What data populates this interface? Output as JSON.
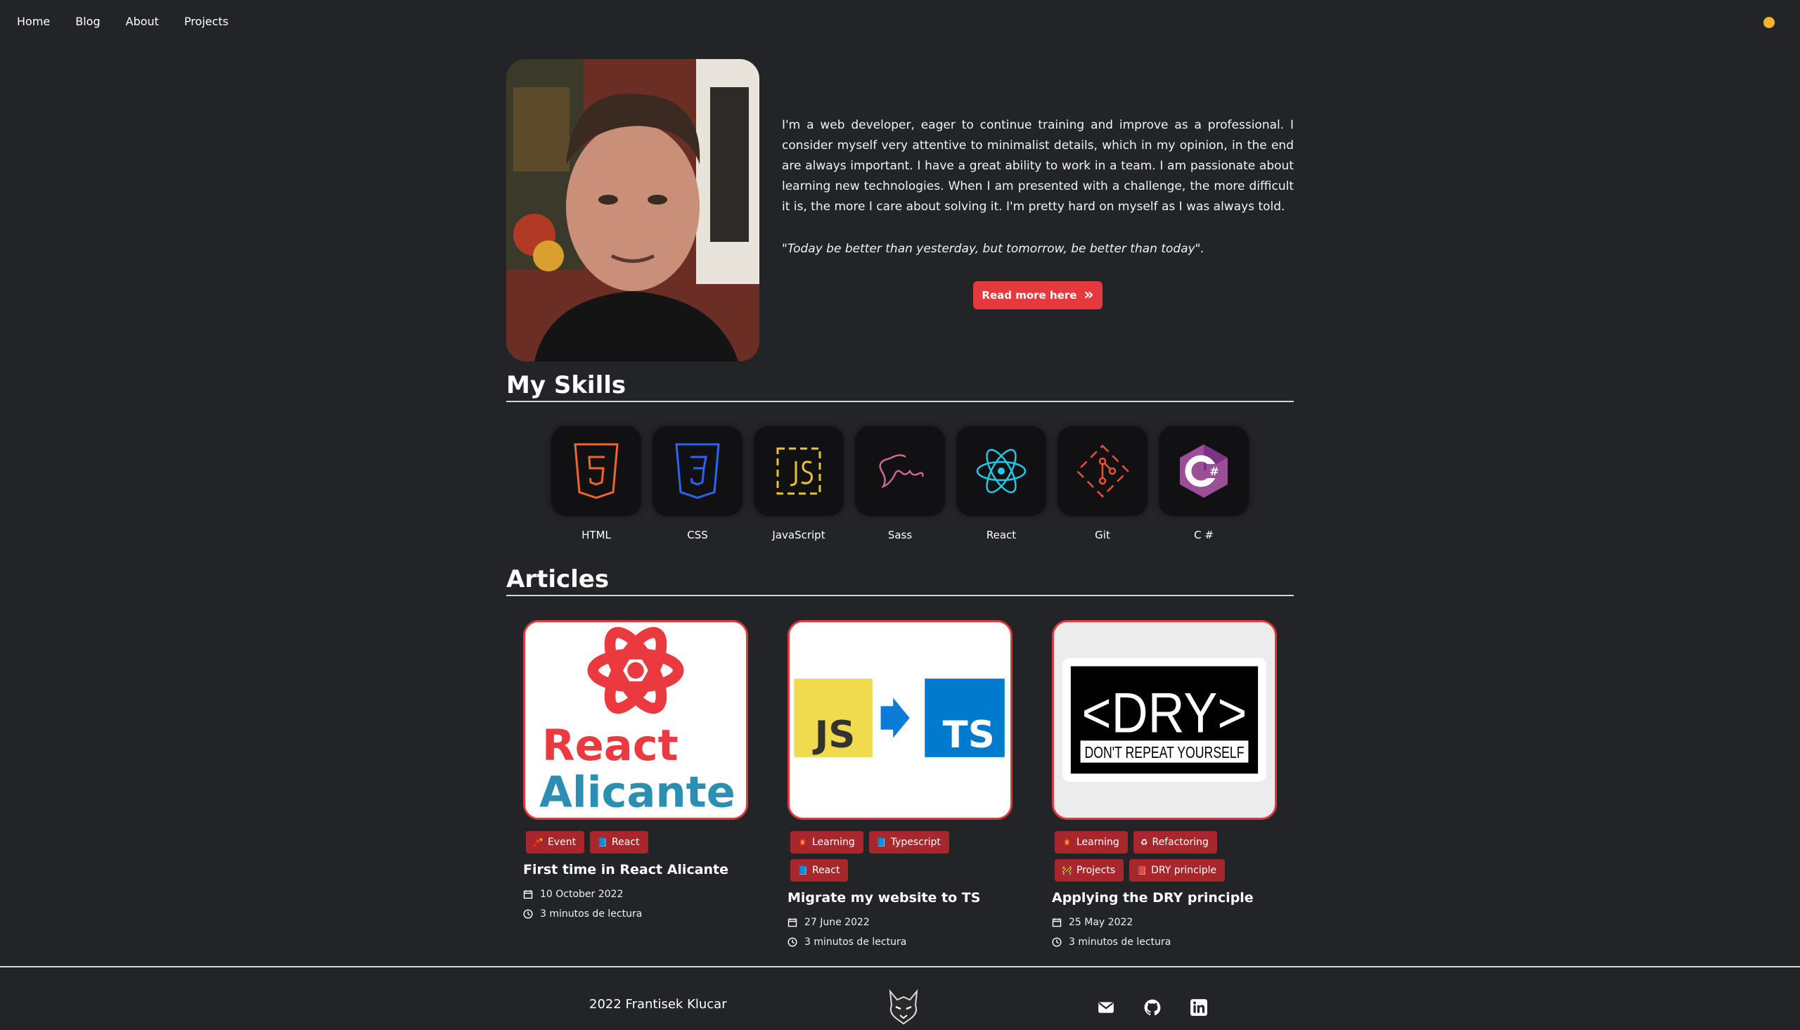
{
  "nav": {
    "items": [
      {
        "label": "Home"
      },
      {
        "label": "Blog"
      },
      {
        "label": "About"
      },
      {
        "label": "Projects"
      }
    ]
  },
  "theme_toggle": {
    "color": "#f2b42c"
  },
  "hero": {
    "bio": "I'm a web developer, eager to continue training and improve as a professional. I consider myself very attentive to minimalist details, which in my opinion, in the end are always important. I have a great ability to work in a team. I am passionate about learning new technologies. When I am presented with a challenge, the more difficult it is, the more I care about solving it. I'm pretty hard on myself as I was always told.",
    "quote": "\"Today be better than yesterday, but tomorrow, be better than today\".",
    "read_more_label": "Read more here"
  },
  "skills": {
    "title": "My Skills",
    "items": [
      {
        "label": "HTML",
        "icon": "html5-icon"
      },
      {
        "label": "CSS",
        "icon": "css3-icon"
      },
      {
        "label": "JavaScript",
        "icon": "javascript-icon"
      },
      {
        "label": "Sass",
        "icon": "sass-icon"
      },
      {
        "label": "React",
        "icon": "react-icon"
      },
      {
        "label": "Git",
        "icon": "git-icon"
      },
      {
        "label": "C #",
        "icon": "csharp-icon"
      }
    ]
  },
  "articles": {
    "title": "Articles",
    "items": [
      {
        "title": "First time in React Alicante",
        "date": "10 October 2022",
        "read_time": "3 minutos de lectura",
        "tags": [
          {
            "label": "Event",
            "icon": "🧨"
          },
          {
            "label": "React",
            "icon": "📘"
          }
        ],
        "thumb_text": [
          "React",
          "Alicante"
        ]
      },
      {
        "title": "Migrate my website to TS",
        "date": "27 June 2022",
        "read_time": "3 minutos de lectura",
        "tags": [
          {
            "label": "Learning",
            "icon": "🏮"
          },
          {
            "label": "Typescript",
            "icon": "📘"
          },
          {
            "label": "React",
            "icon": "📘"
          }
        ],
        "thumb_text": [
          "JS",
          "TS"
        ]
      },
      {
        "title": "Applying the DRY principle",
        "date": "25 May 2022",
        "read_time": "3 minutos de lectura",
        "tags": [
          {
            "label": "Learning",
            "icon": "🏮"
          },
          {
            "label": "Refactoring",
            "icon": "♻"
          },
          {
            "label": "Projects",
            "icon": "🚧"
          },
          {
            "label": "DRY principle",
            "icon": "📕"
          }
        ],
        "thumb_text": [
          "<DRY>",
          "DON'T REPEAT YOURSELF"
        ]
      }
    ]
  },
  "footer": {
    "copyright": "2022 Frantisek Klucar",
    "social": [
      "mail-icon",
      "github-icon",
      "linkedin-icon"
    ]
  },
  "colors": {
    "background": "#232428",
    "accent": "#e5393d",
    "tag_bg": "#a8272c"
  }
}
